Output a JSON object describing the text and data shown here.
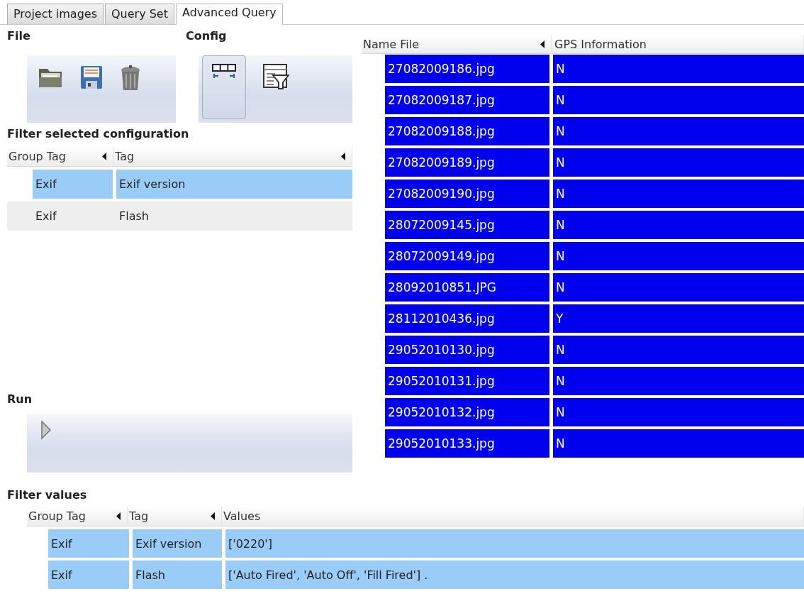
{
  "tabs": [
    {
      "label": "Project images",
      "selected": false
    },
    {
      "label": "Query Set",
      "selected": false
    },
    {
      "label": "Advanced Query",
      "selected": true
    }
  ],
  "file_toolbar": {
    "title": "File",
    "buttons": [
      {
        "kind": "open",
        "pressed": false
      },
      {
        "kind": "save",
        "pressed": false
      },
      {
        "kind": "delete",
        "pressed": false
      }
    ]
  },
  "config_toolbar": {
    "title": "Config",
    "buttons": [
      {
        "kind": "columns",
        "pressed": true
      },
      {
        "kind": "filter",
        "pressed": false
      }
    ]
  },
  "filter_config": {
    "title": "Filter selected configuration",
    "columns": [
      {
        "label": "Group Tag",
        "arrow": true
      },
      {
        "label": "Tag",
        "arrow": true
      }
    ],
    "rows": [
      {
        "cells": [
          "Exif",
          "Exif version"
        ],
        "selected": true
      },
      {
        "cells": [
          "Exif",
          "Flash"
        ],
        "selected": false
      }
    ]
  },
  "run": {
    "title": "Run",
    "buttons": [
      {
        "kind": "play",
        "pressed": false
      }
    ]
  },
  "results": {
    "columns": [
      {
        "label": "Name File",
        "arrow": true
      },
      {
        "label": "GPS Information",
        "arrow": false
      }
    ],
    "rows": [
      {
        "cells": [
          "27082009186.jpg",
          "N"
        ],
        "selected": true
      },
      {
        "cells": [
          "27082009187.jpg",
          "N"
        ],
        "selected": true
      },
      {
        "cells": [
          "27082009188.jpg",
          "N"
        ],
        "selected": true
      },
      {
        "cells": [
          "27082009189.jpg",
          "N"
        ],
        "selected": true
      },
      {
        "cells": [
          "27082009190.jpg",
          "N"
        ],
        "selected": true
      },
      {
        "cells": [
          "28072009145.jpg",
          "N"
        ],
        "selected": true
      },
      {
        "cells": [
          "28072009149.jpg",
          "N"
        ],
        "selected": true
      },
      {
        "cells": [
          "28092010851.JPG",
          "N"
        ],
        "selected": true
      },
      {
        "cells": [
          "28112010436.jpg",
          "Y"
        ],
        "selected": true
      },
      {
        "cells": [
          "29052010130.jpg",
          "N"
        ],
        "selected": true
      },
      {
        "cells": [
          "29052010131.jpg",
          "N"
        ],
        "selected": true
      },
      {
        "cells": [
          "29052010132.jpg",
          "N"
        ],
        "selected": true
      },
      {
        "cells": [
          "29052010133.jpg",
          "N"
        ],
        "selected": true
      }
    ]
  },
  "filter_values": {
    "title": "Filter values",
    "columns": [
      {
        "label": "Group Tag",
        "arrow": true
      },
      {
        "label": "Tag",
        "arrow": true
      },
      {
        "label": "Values",
        "arrow": false
      }
    ],
    "rows": [
      {
        "cells": [
          "Exif",
          "Exif version",
          "['0220']"
        ],
        "selected": true
      },
      {
        "cells": [
          "Exif",
          "Flash",
          "['Auto Fired', 'Auto Off', 'Fill Fired']   ."
        ],
        "selected": true
      }
    ]
  }
}
